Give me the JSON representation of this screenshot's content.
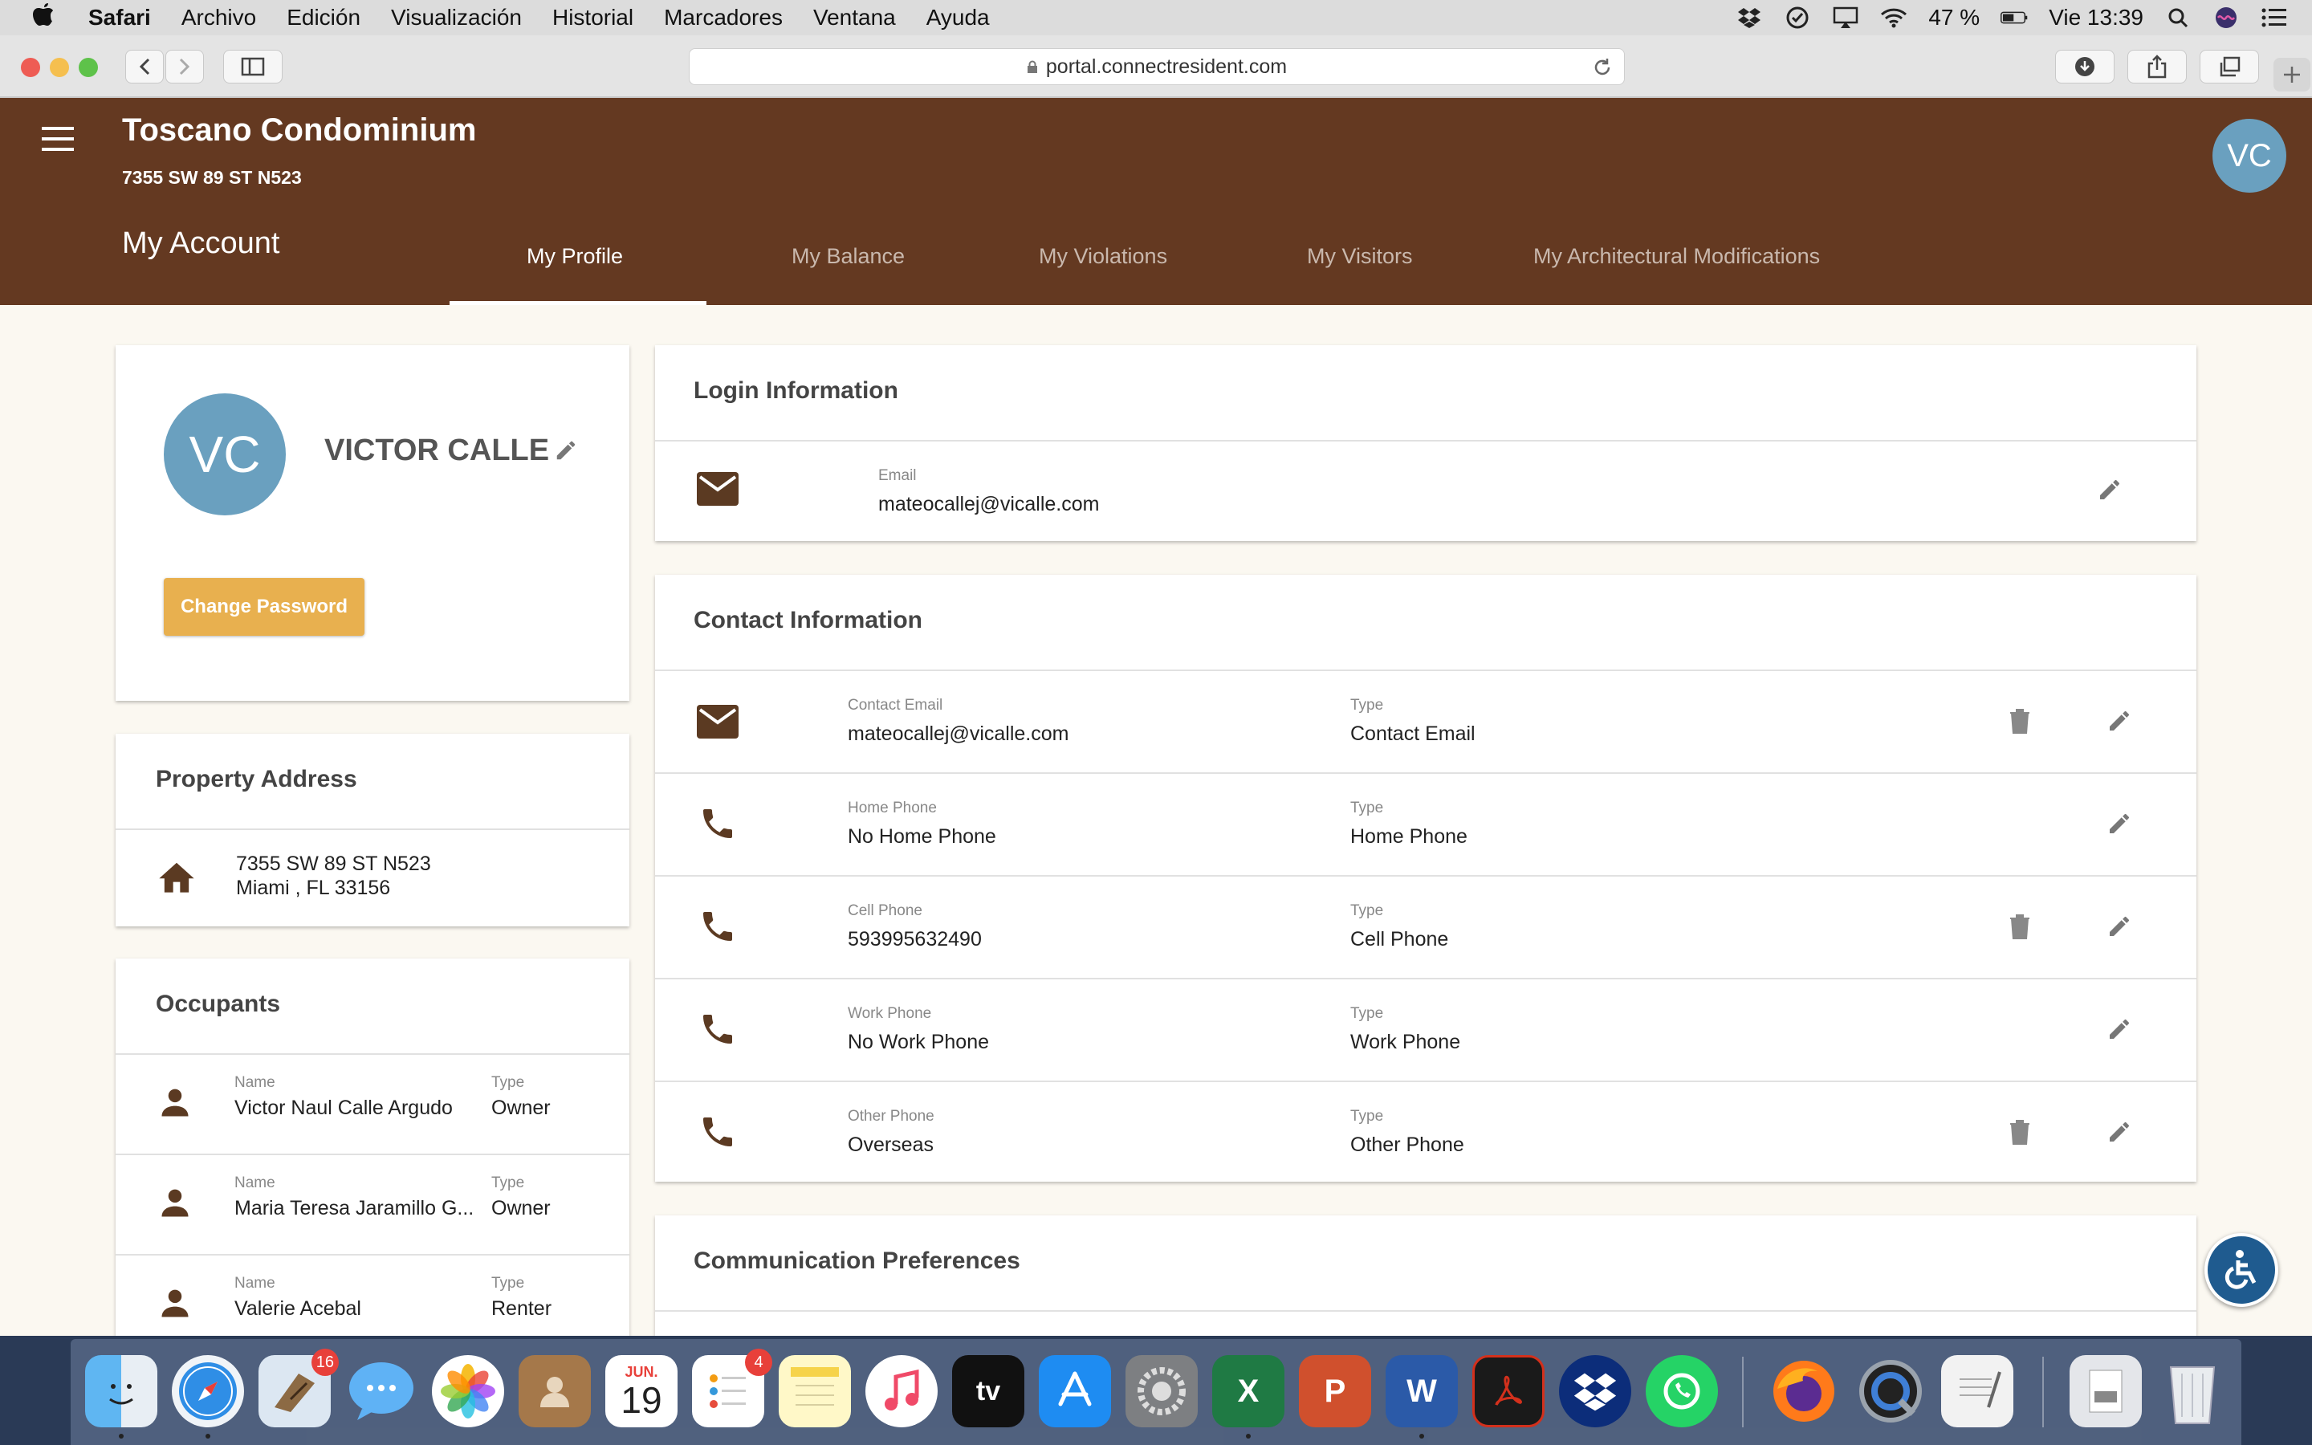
{
  "menubar": {
    "app": "Safari",
    "items": [
      "Archivo",
      "Edición",
      "Visualización",
      "Historial",
      "Marcadores",
      "Ventana",
      "Ayuda"
    ],
    "battery": "47 %",
    "clock": "Vie 13:39"
  },
  "browser": {
    "url": "portal.connectresident.com"
  },
  "header": {
    "community_name": "Toscano Condominium",
    "unit_address": "7355 SW 89 ST N523",
    "section_title": "My Account",
    "avatar_initials": "VC",
    "tabs": [
      {
        "label": "My Profile",
        "active": true
      },
      {
        "label": "My Balance",
        "active": false
      },
      {
        "label": "My Violations",
        "active": false
      },
      {
        "label": "My Visitors",
        "active": false
      },
      {
        "label": "My Architectural Modifications",
        "active": false
      }
    ]
  },
  "profile": {
    "initials": "VC",
    "name": "VICTOR CALLE",
    "change_password_label": "Change Password"
  },
  "property": {
    "title": "Property Address",
    "line1": "7355 SW 89 ST N523",
    "line2": "Miami , FL 33156"
  },
  "occupants": {
    "title": "Occupants",
    "name_label": "Name",
    "type_label": "Type",
    "rows": [
      {
        "name": "Victor Naul Calle Argudo",
        "type": "Owner"
      },
      {
        "name": "Maria Teresa Jaramillo G...",
        "type": "Owner"
      },
      {
        "name": "Valerie Acebal",
        "type": "Renter"
      }
    ]
  },
  "login": {
    "title": "Login Information",
    "email_label": "Email",
    "email": "mateocallej@vicalle.com"
  },
  "contact": {
    "title": "Contact Information",
    "type_label": "Type",
    "rows": [
      {
        "label": "Contact Email",
        "value": "mateocallej@vicalle.com",
        "type": "Contact Email",
        "icon": "email-icon",
        "deletable": true
      },
      {
        "label": "Home Phone",
        "value": "No Home Phone",
        "type": "Home Phone",
        "icon": "phone-icon",
        "deletable": false
      },
      {
        "label": "Cell Phone",
        "value": "593995632490",
        "type": "Cell Phone",
        "icon": "phone-icon",
        "deletable": true
      },
      {
        "label": "Work Phone",
        "value": "No Work Phone",
        "type": "Work Phone",
        "icon": "phone-icon",
        "deletable": false
      },
      {
        "label": "Other Phone",
        "value": "Overseas",
        "type": "Other Phone",
        "icon": "phone-icon",
        "deletable": true
      }
    ]
  },
  "communication": {
    "title": "Communication Preferences"
  },
  "dock": {
    "mail_badge": "16",
    "calendar_month": "JUN.",
    "calendar_day": "19",
    "reminders_badge": "4",
    "tv_label": "tv"
  },
  "colors": {
    "header_brown": "#643921",
    "icon_brown": "#5b3a22",
    "avatar_blue": "#6aa0bf",
    "button_gold": "#e8b04f",
    "page_bg": "#fbf8f1"
  }
}
